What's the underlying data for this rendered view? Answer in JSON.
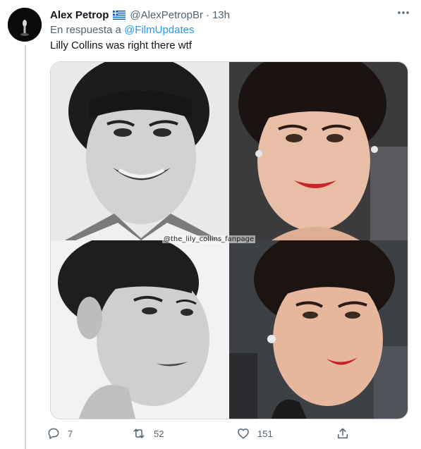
{
  "tweet": {
    "author_name": "Alex Petrop",
    "author_handle": "@AlexPetropBr",
    "separator": "·",
    "time": "13h",
    "reply_prefix": "En respuesta a",
    "reply_mention": "@FilmUpdates",
    "text": "Lilly Collins was right there wtf",
    "media_watermark": "@the_lily_collins_fanpage",
    "flag_icon": "greece-flag-icon"
  },
  "actions": {
    "reply_count": "7",
    "retweet_count": "52",
    "like_count": "151"
  },
  "colors": {
    "accent": "#1d9bf0",
    "secondary_text": "#536471",
    "border": "#cfd9de"
  }
}
